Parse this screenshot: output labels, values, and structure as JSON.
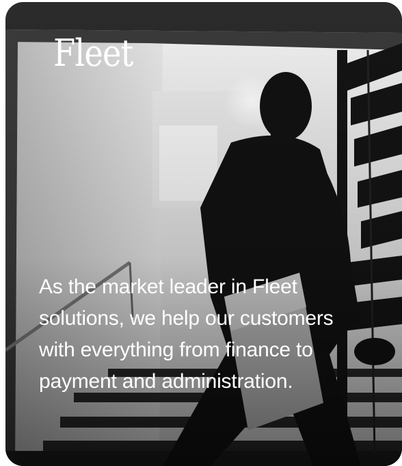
{
  "card": {
    "title": "Fleet",
    "description": "As the market leader in Fleet solutions, we help our customers with everything from finance to payment and administration."
  }
}
